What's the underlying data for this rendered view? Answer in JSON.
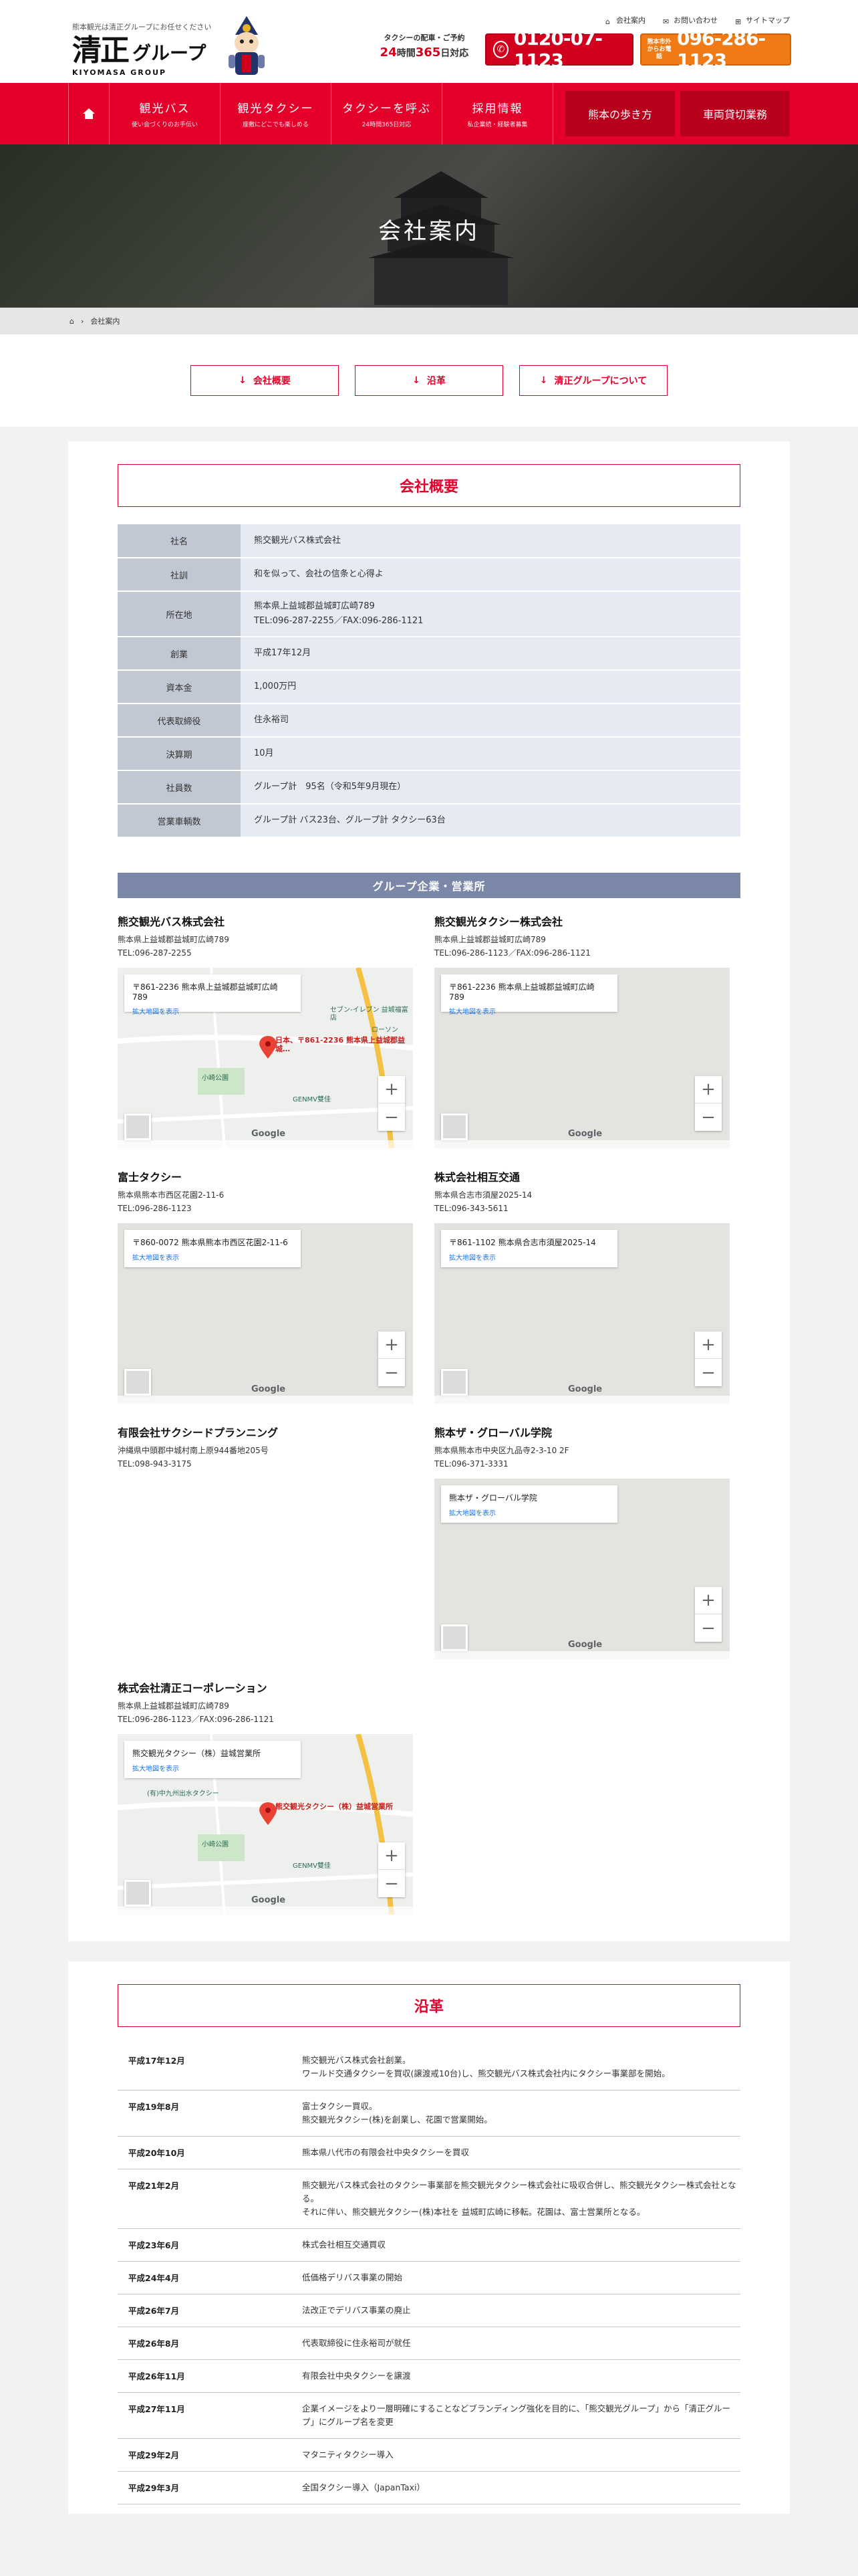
{
  "header": {
    "tagline": "熊本観光は清正グループにお任せください",
    "logo_kanji": "清正",
    "logo_group": "グループ",
    "logo_sub": "KIYOMASA GROUP",
    "util_links": [
      "会社案内",
      "お問い合わせ",
      "サイトマップ"
    ],
    "hours_caption": "タクシーの配車・ご予約",
    "hours_24": "24",
    "hours_mid": "時間",
    "hours_365": "365",
    "hours_end": "日対応",
    "tel_free": "0120-07-1123",
    "tel_local_label": "熊本市外からお電話",
    "tel_local": "096-286-1123"
  },
  "nav": {
    "items": [
      {
        "title": "観光バス",
        "sub": "使い会づくりのお手伝い"
      },
      {
        "title": "観光タクシー",
        "sub": "座敷にどこでも楽しめる"
      },
      {
        "title": "タクシーを呼ぶ",
        "sub": "24時間365日対応"
      },
      {
        "title": "採用情報",
        "sub": "私企業続・経験者募集"
      }
    ],
    "dark_items": [
      "熊本の歩き方",
      "車両貸切業務"
    ]
  },
  "hero_title": "会社案内",
  "breadcrumb": {
    "current": "会社案内"
  },
  "anchors": [
    "会社概要",
    "沿革",
    "清正グループについて"
  ],
  "overview": {
    "title": "会社概要",
    "rows": [
      {
        "k": "社名",
        "v": [
          "熊交観光バス株式会社"
        ]
      },
      {
        "k": "社訓",
        "v": [
          "和を似って、会社の信条と心得よ"
        ]
      },
      {
        "k": "所在地",
        "v": [
          "熊本県上益城郡益城町広崎789",
          "TEL:096-287-2255／FAX:096-286-1121"
        ]
      },
      {
        "k": "創業",
        "v": [
          "平成17年12月"
        ]
      },
      {
        "k": "資本金",
        "v": [
          "1,000万円"
        ]
      },
      {
        "k": "代表取締役",
        "v": [
          "住永裕司"
        ]
      },
      {
        "k": "決算期",
        "v": [
          "10月"
        ]
      },
      {
        "k": "社員数",
        "v": [
          "グループ計　95名（令和5年9月現在）"
        ]
      },
      {
        "k": "営業車輌数",
        "v": [
          "グループ計 バス23台、グループ計 タクシー63台"
        ]
      }
    ]
  },
  "group_title": "グループ企業・営業所",
  "companies": [
    {
      "name": "熊交観光バス株式会社",
      "addr": "熊本県上益城郡益城町広崎789",
      "tel": "TEL:096-287-2255",
      "map_info": "〒861-2236 熊本県上益城郡益城町広崎789",
      "map_link": "拡大地図を表示",
      "pin_label": "日本、〒861-2236 熊本県上益城郡益城…"
    },
    {
      "name": "熊交観光タクシー株式会社",
      "addr": "熊本県上益城郡益城町広崎789",
      "tel": "TEL:096-286-1123／FAX:096-286-1121",
      "map_info": "〒861-2236 熊本県上益城郡益城町広崎789",
      "map_link": "拡大地図を表示"
    },
    {
      "name": "富士タクシー",
      "addr": "熊本県熊本市西区花園2-11-6",
      "tel": "TEL:096-286-1123",
      "map_info": "〒860-0072 熊本県熊本市西区花園2-11-6",
      "map_link": "拡大地図を表示"
    },
    {
      "name": "株式会社相互交通",
      "addr": "熊本県合志市須屋2025-14",
      "tel": "TEL:096-343-5611",
      "map_info": "〒861-1102 熊本県合志市須屋2025-14",
      "map_link": "拡大地図を表示"
    },
    {
      "name": "有限会社サクシードプランニング",
      "addr": "沖縄県中頭郡中城村南上原944番地205号",
      "tel": "TEL:098-943-3175"
    },
    {
      "name": "熊本ザ・グローバル学院",
      "addr": "熊本県熊本市中央区九品寺2-3-10 2F",
      "tel": "TEL:096-371-3331",
      "map_info": "熊本ザ・グローバル学院",
      "map_link": "拡大地図を表示"
    },
    {
      "name": "株式会社清正コーポレーション",
      "addr": "熊本県上益城郡益城町広崎789",
      "tel": "TEL:096-286-1123／FAX:096-286-1121",
      "map_info": "熊交観光タクシー（株）益城営業所",
      "map_link": "拡大地図を表示",
      "pin_label": "熊交観光タクシー（株）益城営業所"
    }
  ],
  "map_labels": {
    "google": "Google",
    "zoom_in": "+",
    "zoom_out": "−",
    "poi_seven": "セブン-イレブン 益城福富店",
    "poi_lawson": "ローソン",
    "poi_park": "小崎公園",
    "poi_genmv": "GENMV雙佳",
    "poi_office": "(有)中九州出水タクシー"
  },
  "history": {
    "title": "沿革",
    "rows": [
      {
        "d": "平成17年12月",
        "t": [
          "熊交観光バス株式会社創業。",
          "ワールド交通タクシーを買収(譲渡戒10台)し、熊交観光バス株式会社内にタクシー事業部を開始。"
        ]
      },
      {
        "d": "平成19年8月",
        "t": [
          "富士タクシー買収。",
          "熊交観光タクシー(株)を創業し、花園で営業開始。"
        ]
      },
      {
        "d": "平成20年10月",
        "t": [
          "熊本県八代市の有限会社中央タクシーを買収"
        ]
      },
      {
        "d": "平成21年2月",
        "t": [
          "熊交観光バス株式会社のタクシー事業部を熊交観光タクシー株式会社に吸収合併し、熊交観光タクシー株式会社となる。",
          "それに伴い、熊交観光タクシー(株)本社を 益城町広崎に移転。花園は、富士営業所となる。"
        ]
      },
      {
        "d": "平成23年6月",
        "t": [
          "株式会社相互交通買収"
        ]
      },
      {
        "d": "平成24年4月",
        "t": [
          "低価格デリバス事業の開始"
        ]
      },
      {
        "d": "平成26年7月",
        "t": [
          "法改正でデリバス事業の廃止"
        ]
      },
      {
        "d": "平成26年8月",
        "t": [
          "代表取締役に住永裕司が就任"
        ]
      },
      {
        "d": "平成26年11月",
        "t": [
          "有限会社中央タクシーを譲渡"
        ]
      },
      {
        "d": "平成27年11月",
        "t": [
          "企業イメージをより一層明確にすることなどブランディング強化を目的に、「熊交観光グループ」から「清正グループ」にグループ名を変更"
        ]
      },
      {
        "d": "平成29年2月",
        "t": [
          "マタニティタクシー導入"
        ]
      },
      {
        "d": "平成29年3月",
        "t": [
          "全国タクシー導入（JapanTaxi）"
        ]
      }
    ]
  },
  "colors": {
    "brand_red": "#e4002b",
    "dark_red": "#b8001d",
    "orange": "#f07b16",
    "table_key": "#c2c8d3",
    "table_val": "#e6eaf2",
    "group_bar": "#7b87a8"
  }
}
